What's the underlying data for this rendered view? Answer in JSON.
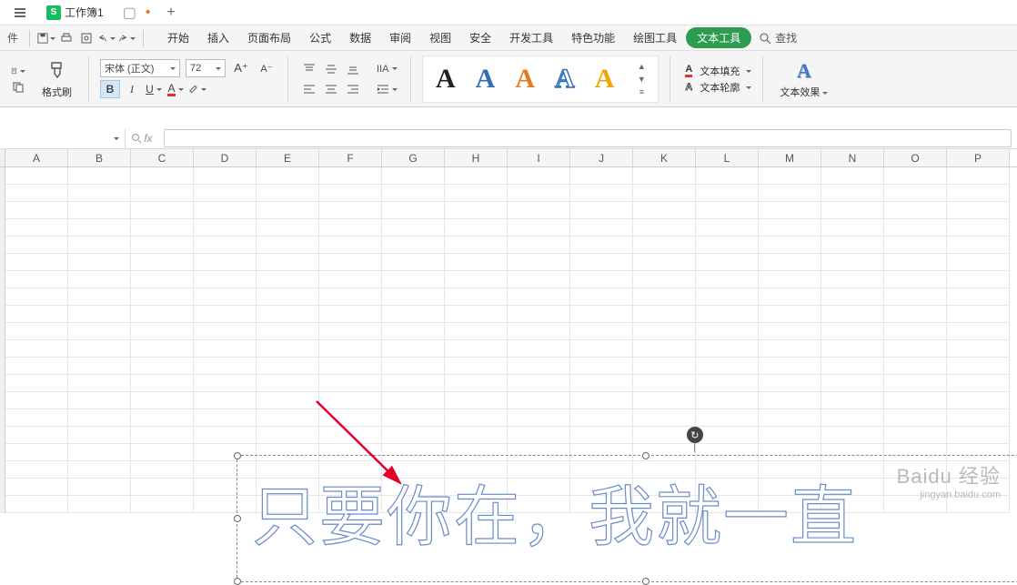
{
  "title_bar": {
    "file_tab": "工作簿1",
    "file_icon": "S"
  },
  "quick_access": {
    "file_label": "件"
  },
  "menu_tabs": [
    "开始",
    "插入",
    "页面布局",
    "公式",
    "数据",
    "审阅",
    "视图",
    "安全",
    "开发工具",
    "特色功能",
    "绘图工具",
    "文本工具"
  ],
  "active_tab_index": 11,
  "search_label": "查找",
  "ribbon": {
    "format_painter": "格式刷",
    "font_name": "宋体 (正文)",
    "font_size": "72",
    "bold": "B",
    "italic": "I",
    "underline": "U",
    "wordart_letter": "A",
    "text_fill": "文本填充",
    "text_outline": "文本轮廓",
    "text_effects": "文本效果"
  },
  "namebox_dd": "▾",
  "fx": "fx",
  "columns": [
    "A",
    "B",
    "C",
    "D",
    "E",
    "F",
    "G",
    "H",
    "I",
    "J",
    "K",
    "L",
    "M",
    "N",
    "O",
    "P"
  ],
  "textbox_content": "只要你在，我就一直",
  "watermark": {
    "brand": "Baidu 经验",
    "url": "jingyan.baidu.com"
  }
}
